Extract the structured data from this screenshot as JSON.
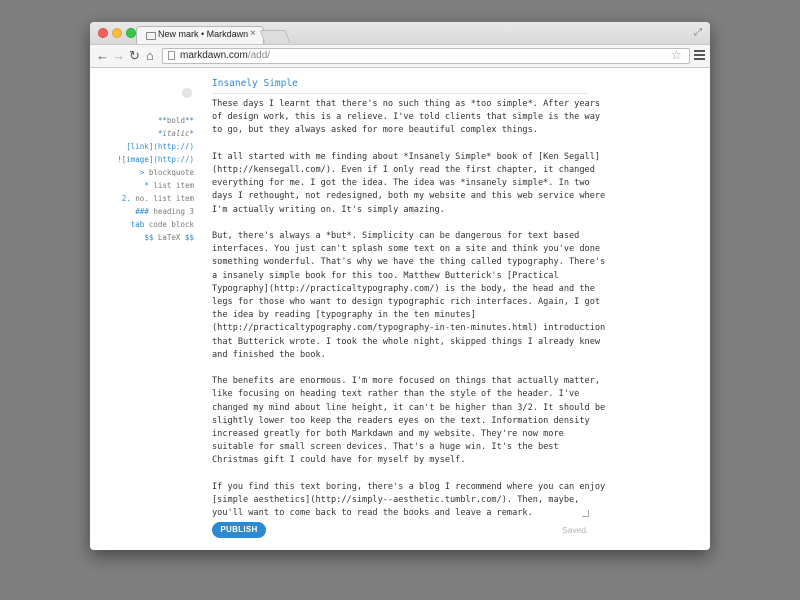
{
  "browser": {
    "tab_title": "New mark • Markdawn",
    "tab_close": "×",
    "url_host": "markdawn.com",
    "url_path": "/add/",
    "back_glyph": "←",
    "forward_glyph": "→",
    "reload_glyph": "↻",
    "home_glyph": "⌂",
    "star_glyph": "☆",
    "fullscreen_glyph": "⤢"
  },
  "sidebar": {
    "collapse_glyph": "›",
    "cheatsheet": [
      {
        "mk_pre": "**",
        "text": "bold",
        "mk_post": "**"
      },
      {
        "mk_pre": "*",
        "text": "italic",
        "mk_post": "*"
      },
      {
        "mk_pre": "",
        "text": "[link](http://)",
        "mk_post": ""
      },
      {
        "mk_pre": "!",
        "text": "[image](http://)",
        "mk_post": ""
      },
      {
        "mk_pre": ">",
        "text": " blockquote",
        "mk_post": ""
      },
      {
        "mk_pre": "*",
        "text": " list item",
        "mk_post": ""
      },
      {
        "mk_pre": "2.",
        "text": " no. list item",
        "mk_post": ""
      },
      {
        "mk_pre": "###",
        "text": " heading 3",
        "mk_post": ""
      },
      {
        "mk_pre": "tab",
        "text": " code block",
        "mk_post": ""
      },
      {
        "mk_pre": "$$",
        "text": " LaTeX ",
        "mk_post": "$$"
      }
    ]
  },
  "editor": {
    "title": "Insanely Simple",
    "body": "These days I learnt that there's no such thing as *too simple*. After years\nof design work, this is a relieve. I've told clients that simple is the way\nto go, but they always asked for more beautiful complex things.\n\nIt all started with me finding about *Insanely Simple* book of [Ken Segall]\n(http://kensegall.com/). Even if I only read the first chapter, it changed\neverything for me. I got the idea. The idea was *insanely simple*. In two\ndays I rethought, not redesigned, both my website and this web service where\nI'm actually writing on. It's simply amazing.\n\nBut, there's always a *but*. Simplicity can be dangerous for text based\ninterfaces. You just can't splash some text on a site and think you've done\nsomething wonderful. That's why we have the thing called typography. There's\na insanely simple book for this too. Matthew Butterick's [Practical\nTypography](http://practicaltypography.com/) is the body, the head and the\nlegs for those who want to design typographic rich interfaces. Again, I got\nthe idea by reading [typography in the ten minutes]\n(http://practicaltypography.com/typography-in-ten-minutes.html) introduction\nthat Butterick wrote. I took the whole night, skipped things I already knew\nand finished the book.\n\nThe benefits are enormous. I'm more focused on things that actually matter,\nlike focusing on heading text rather than the style of the header. I've\nchanged my mind about line height, it can't be higher than 3/2. It should be\nslightly lower too keep the readers eyes on the text. Information density\nincreased greatly for both Markdawn and my website. They're now more\nsuitable for small screen devices. That's a huge win. It's the best\nChristmas gift I could have for myself by myself.\n\nIf you find this text boring, there's a blog I recommend where you can enjoy\n[simple aesthetics](http://simply--aesthetic.tumblr.com/). Then, maybe,\nyou'll want to come back to read the books and leave a remark.",
    "publish_label": "PUBLISH",
    "status": "Saved."
  },
  "colors": {
    "accent": "#2d8ad0",
    "muted": "#b4b4b4"
  }
}
